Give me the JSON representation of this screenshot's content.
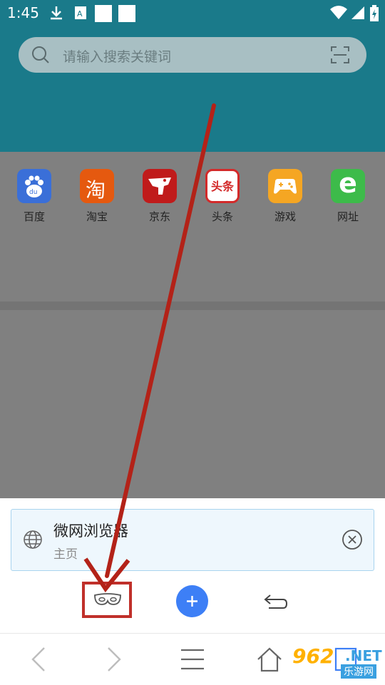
{
  "status_bar": {
    "time": "1:45"
  },
  "search": {
    "placeholder": "请输入搜索关键词"
  },
  "quick_links": [
    {
      "label": "百度",
      "icon": "baidu-icon",
      "color": "#3a6fd8"
    },
    {
      "label": "淘宝",
      "icon": "taobao-icon",
      "color": "#e5590f",
      "glyph": "淘"
    },
    {
      "label": "京东",
      "icon": "jd-icon",
      "color": "#c01b1b"
    },
    {
      "label": "头条",
      "icon": "toutiao-icon",
      "color": "#d32a2a",
      "glyph": "头条"
    },
    {
      "label": "游戏",
      "icon": "gamepad-icon",
      "color": "#f5a623"
    },
    {
      "label": "网址",
      "icon": "web-e-icon",
      "color": "#3dbb4a",
      "glyph": "e"
    }
  ],
  "tab": {
    "title": "微网浏览器",
    "subtitle": "主页"
  },
  "watermark": {
    "brand": "962",
    "suffix": ".NET",
    "site": "乐游网"
  },
  "colors": {
    "header": "#1a7a8a",
    "accent": "#3d7ff6",
    "highlight": "#c0302a"
  }
}
